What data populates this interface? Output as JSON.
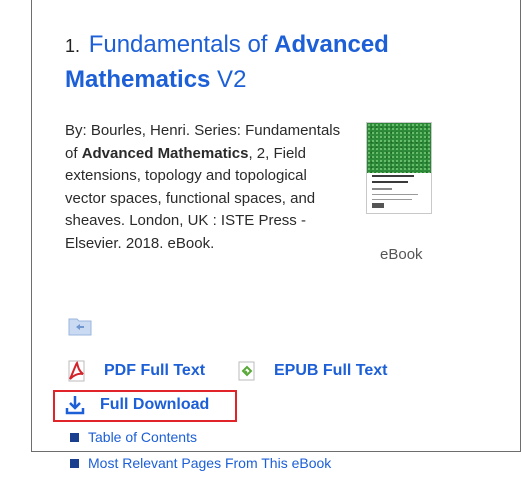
{
  "result": {
    "number": "1.",
    "title_parts": [
      {
        "text": "Fundamentals of ",
        "bold": false
      },
      {
        "text": "Advanced",
        "bold": true
      },
      {
        "text": "Mathematics",
        "bold": true
      },
      {
        "text": " V2",
        "bold": false
      }
    ],
    "description": {
      "part1": "By: Bourles, Henri. Series: Fundamentals of ",
      "bold1": "Advanced",
      "bold2": "Mathematics",
      "part2": ", 2, Field extensions, topology and topological vector spaces, functional spaces, and sheaves. London, UK : ISTE Press - Elsevier. 2018. eBook."
    },
    "format_label": "eBook",
    "links": {
      "pdf": "PDF Full Text",
      "epub": "EPUB Full Text",
      "download": "Full Download",
      "toc": "Table of Contents",
      "relevant": "Most Relevant Pages From This eBook"
    }
  },
  "colors": {
    "link": "#1c5fd6",
    "highlight_border": "#e0242a",
    "bullet": "#1a3f8f",
    "cover_green": "#2e8b3a"
  },
  "icons": [
    "folder-icon",
    "pdf-icon",
    "epub-icon",
    "download-icon"
  ]
}
